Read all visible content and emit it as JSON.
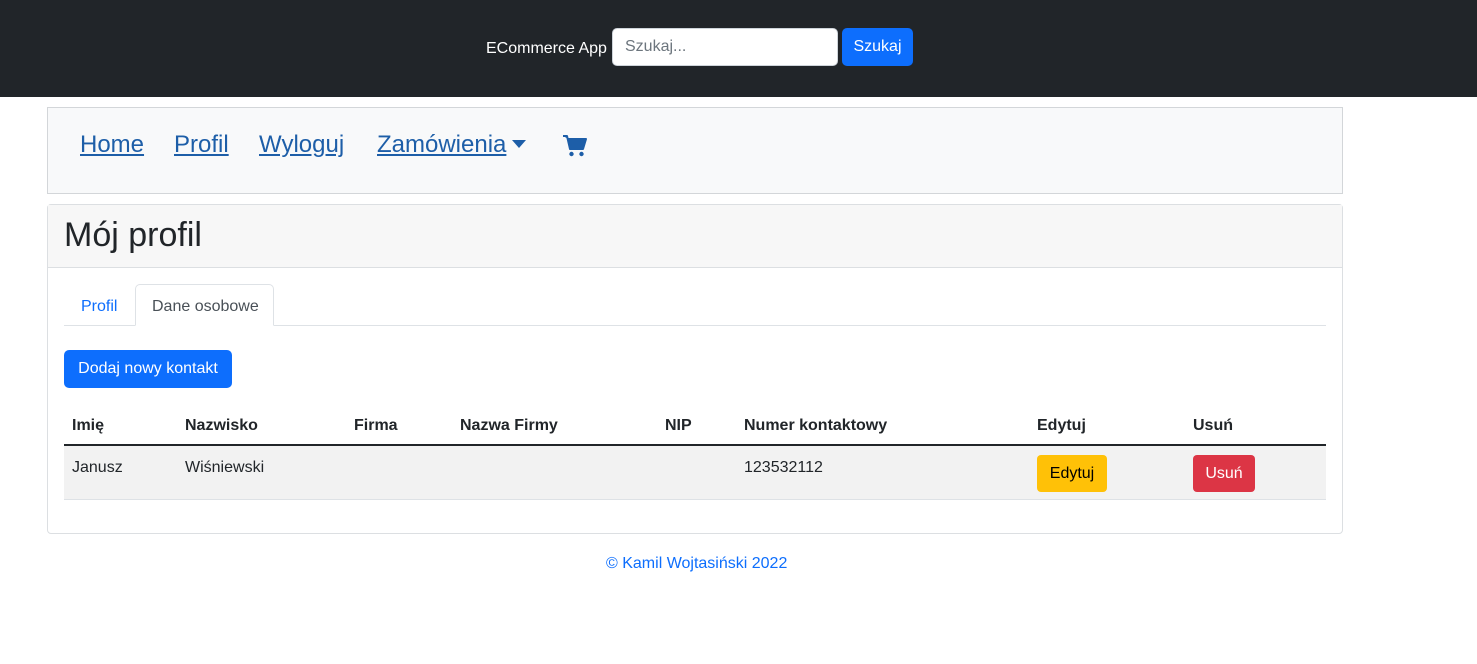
{
  "header": {
    "brand": "ECommerce App",
    "search_placeholder": "Szukaj...",
    "search_button": "Szukaj"
  },
  "nav": {
    "items": [
      {
        "label": "Home"
      },
      {
        "label": "Profil"
      },
      {
        "label": "Wyloguj"
      },
      {
        "label": "Zamówienia"
      }
    ],
    "cart_icon": "shopping-cart-icon"
  },
  "profile": {
    "title": "Mój profil",
    "tabs": [
      {
        "label": "Profil",
        "active": false
      },
      {
        "label": "Dane osobowe",
        "active": true
      }
    ],
    "add_contact_button": "Dodaj nowy kontakt",
    "table": {
      "columns": [
        "Imię",
        "Nazwisko",
        "Firma",
        "Nazwa Firmy",
        "NIP",
        "Numer kontaktowy",
        "Edytuj",
        "Usuń"
      ],
      "rows": [
        {
          "imie": "Janusz",
          "nazwisko": "Wiśniewski",
          "firma": "",
          "nazwa_firmy": "",
          "nip": "",
          "numer": "123532112",
          "edit_label": "Edytuj",
          "delete_label": "Usuń"
        }
      ]
    }
  },
  "footer": {
    "text": "© Kamil Wojtasiński 2022"
  },
  "colors": {
    "topbar": "#212529",
    "primary": "#0d6efd",
    "warning": "#ffc107",
    "danger": "#dc3545",
    "nav_link": "#1d5ea8"
  }
}
